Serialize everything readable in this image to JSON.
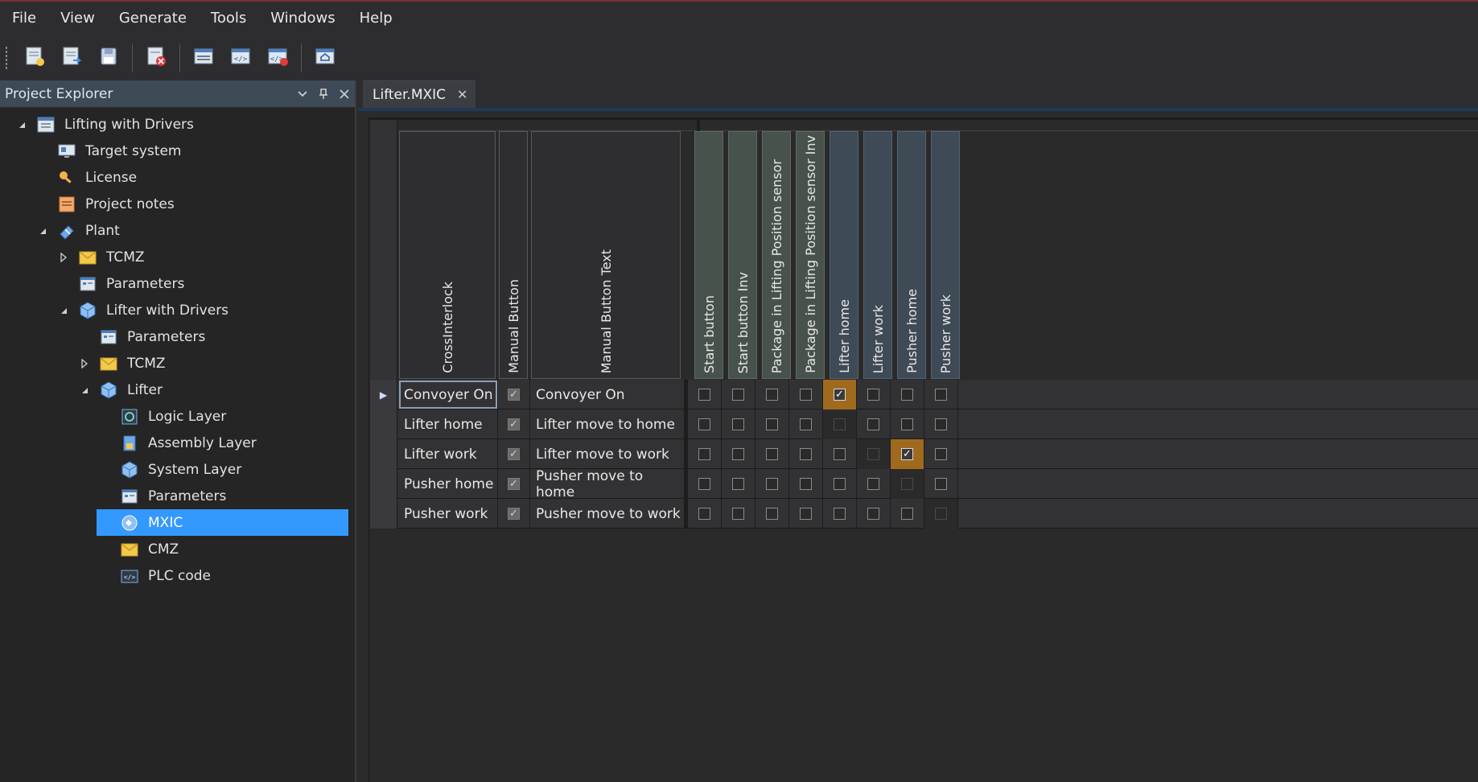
{
  "menu": [
    "File",
    "View",
    "Generate",
    "Tools",
    "Windows",
    "Help"
  ],
  "toolbar": {
    "buttons": [
      "new-project-icon",
      "open-project-icon",
      "save-icon",
      "close-project-icon",
      "layout-icon",
      "generate-code-icon",
      "generate-code-error-icon",
      "home-icon"
    ]
  },
  "explorer": {
    "title": "Project Explorer",
    "items": [
      {
        "label": "Lifting with Drivers",
        "icon": "project-icon",
        "level": 0,
        "expander": "expanded"
      },
      {
        "label": "Target system",
        "icon": "target-system-icon",
        "level": 1,
        "expander": "none"
      },
      {
        "label": "License",
        "icon": "key-icon",
        "level": 1,
        "expander": "none"
      },
      {
        "label": "Project notes",
        "icon": "notes-icon",
        "level": 1,
        "expander": "none"
      },
      {
        "label": "Plant",
        "icon": "plant-icon",
        "level": 1,
        "expander": "expanded"
      },
      {
        "label": "TCMZ",
        "icon": "envelope-icon",
        "level": 2,
        "expander": "collapsed"
      },
      {
        "label": "Parameters",
        "icon": "parameters-icon",
        "level": 2,
        "expander": "none"
      },
      {
        "label": "Lifter with Drivers",
        "icon": "cube-icon",
        "level": 2,
        "expander": "expanded"
      },
      {
        "label": "Parameters",
        "icon": "parameters-icon",
        "level": 3,
        "expander": "none"
      },
      {
        "label": "TCMZ",
        "icon": "envelope-icon",
        "level": 3,
        "expander": "collapsed"
      },
      {
        "label": "Lifter",
        "icon": "cube-icon",
        "level": 3,
        "expander": "expanded"
      },
      {
        "label": "Logic Layer",
        "icon": "logic-layer-icon",
        "level": 4,
        "expander": "none"
      },
      {
        "label": "Assembly Layer",
        "icon": "assembly-layer-icon",
        "level": 4,
        "expander": "none"
      },
      {
        "label": "System Layer",
        "icon": "cube-icon",
        "level": 4,
        "expander": "none"
      },
      {
        "label": "Parameters",
        "icon": "parameters-icon",
        "level": 4,
        "expander": "none"
      },
      {
        "label": "MXIC",
        "icon": "mxic-icon",
        "level": 4,
        "expander": "none",
        "selected": true
      },
      {
        "label": "CMZ",
        "icon": "envelope-icon",
        "level": 4,
        "expander": "none"
      },
      {
        "label": "PLC code",
        "icon": "code-icon",
        "level": 4,
        "expander": "none"
      }
    ]
  },
  "tab": {
    "label": "Lifter.MXIC",
    "close": "✕"
  },
  "grid": {
    "columns": [
      "CrossInterlock",
      "Manual Button",
      "Manual Button Text"
    ],
    "signal_columns": [
      {
        "label": "Start button",
        "tone": "green"
      },
      {
        "label": "Start button Inv",
        "tone": "green"
      },
      {
        "label": "Package in Lifting Position sensor",
        "tone": "green"
      },
      {
        "label": "Package in Lifting Position sensor Inv",
        "tone": "green"
      },
      {
        "label": "Lifter home",
        "tone": "blue"
      },
      {
        "label": "Lifter work",
        "tone": "blue"
      },
      {
        "label": "Pusher home",
        "tone": "blue"
      },
      {
        "label": "Pusher work",
        "tone": "blue"
      }
    ],
    "rows": [
      {
        "name": "Convoyer On",
        "manual": true,
        "text": "Convoyer On",
        "signals": [
          "off",
          "off",
          "off",
          "off",
          "checked",
          "off",
          "off",
          "off"
        ],
        "current": true
      },
      {
        "name": "Lifter home",
        "manual": true,
        "text": "Lifter move to home",
        "signals": [
          "off",
          "off",
          "off",
          "off",
          "disabled",
          "off",
          "off",
          "off"
        ]
      },
      {
        "name": "Lifter work",
        "manual": true,
        "text": "Lifter move to work",
        "signals": [
          "off",
          "off",
          "off",
          "off",
          "off",
          "disabled",
          "checked",
          "off"
        ]
      },
      {
        "name": "Pusher home",
        "manual": true,
        "text": "Pusher move to home",
        "signals": [
          "off",
          "off",
          "off",
          "off",
          "off",
          "off",
          "disabled",
          "off"
        ]
      },
      {
        "name": "Pusher work",
        "manual": true,
        "text": "Pusher move to work",
        "signals": [
          "off",
          "off",
          "off",
          "off",
          "off",
          "off",
          "off",
          "disabled"
        ]
      }
    ],
    "current_row_marker": "▶",
    "check_glyph": "✓",
    "colors": {
      "highlight": "#a06a1e",
      "selection": "#3399ff",
      "green_header": "#48524c",
      "blue_header": "#3e4a56"
    }
  }
}
